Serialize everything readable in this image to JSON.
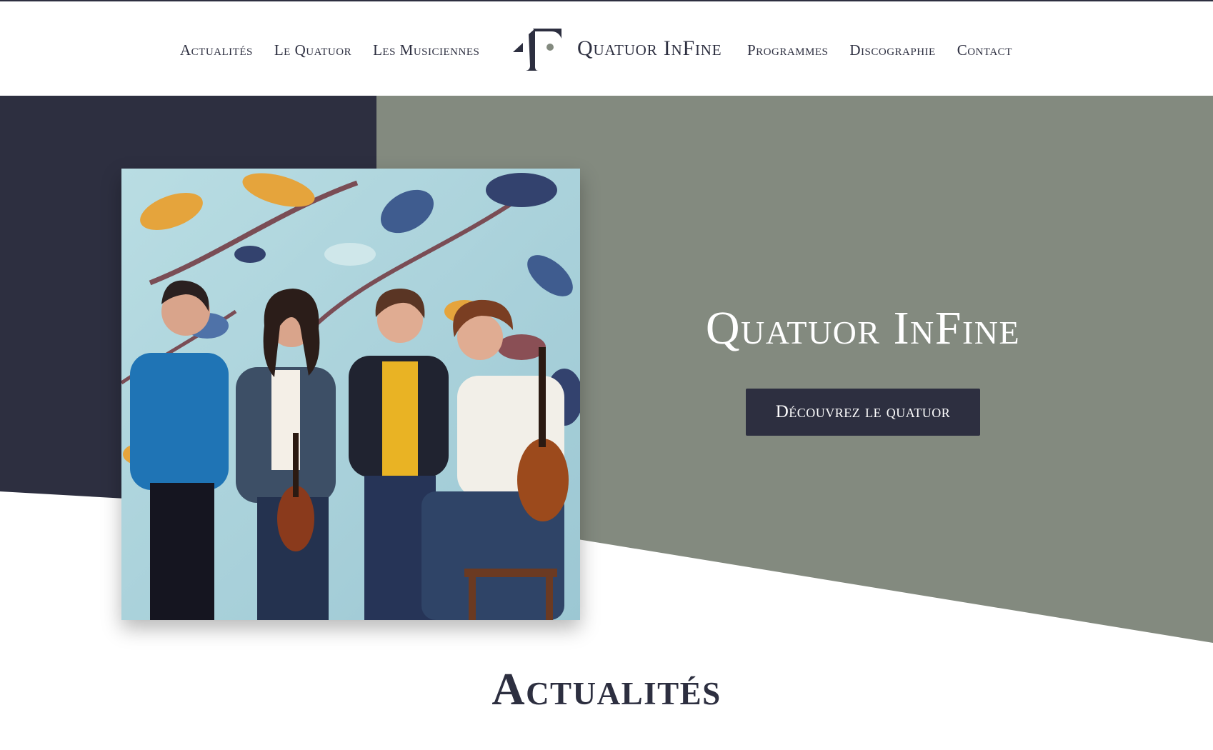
{
  "colors": {
    "navy": "#2d2f40",
    "sage": "#838a7f",
    "white": "#ffffff"
  },
  "header": {
    "nav_left": [
      "Actualités",
      "Le Quatuor",
      "Les Musiciennes"
    ],
    "nav_right": [
      "Programmes",
      "Discographie",
      "Contact"
    ],
    "logo_text": "Quatuor InFine",
    "logo_icon": "infine-monogram-icon"
  },
  "hero": {
    "title": "Quatuor InFine",
    "cta_label": "Découvrez le quatuor",
    "photo": "four-musicians-with-violin-and-viola-photo"
  },
  "sections": {
    "news_title": "Actualités"
  }
}
